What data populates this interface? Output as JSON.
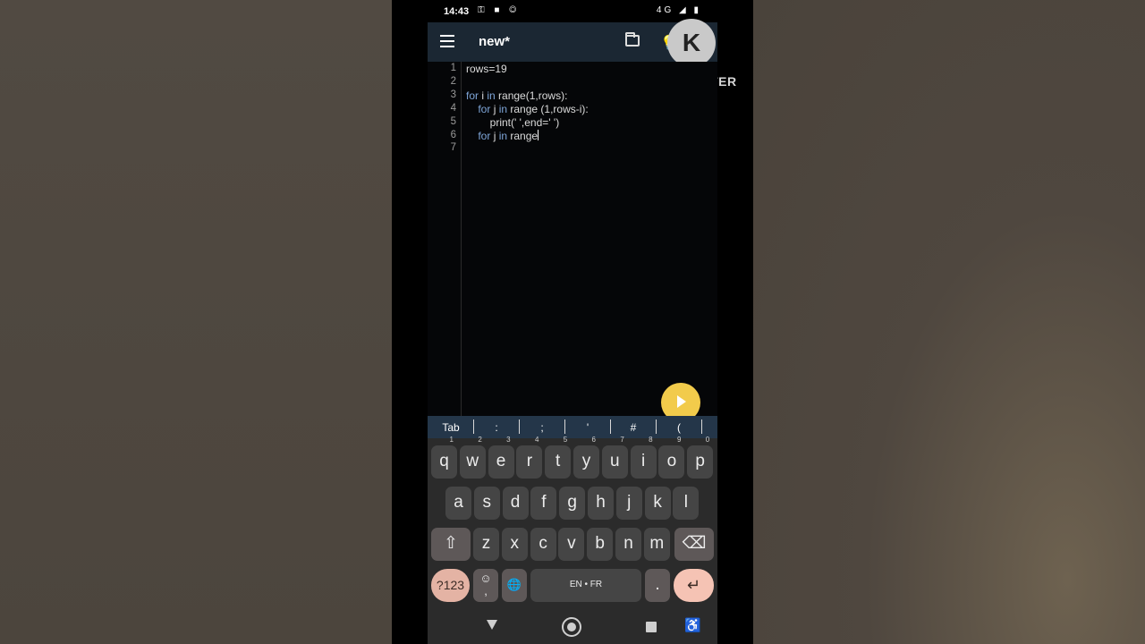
{
  "status_bar": {
    "time": "14:43",
    "left_icons": "⚿ ■ ◎",
    "right_icons": "4G ◢ ▮"
  },
  "app": {
    "title": "new*"
  },
  "overlay": {
    "logo_letter": "K",
    "brand": "KINEMASTER"
  },
  "editor": {
    "lines": [
      {
        "number": "1",
        "indent": "",
        "tokens": [
          {
            "text": "rows=19",
            "kw": false
          }
        ]
      },
      {
        "number": "2",
        "indent": "",
        "tokens": []
      },
      {
        "number": "3",
        "indent": "",
        "tokens": [
          {
            "text": "for",
            "kw": true
          },
          {
            "text": " i ",
            "kw": false
          },
          {
            "text": "in",
            "kw": true
          },
          {
            "text": " range(1,rows):",
            "kw": false
          }
        ]
      },
      {
        "number": "4",
        "indent": "  ",
        "tokens": [
          {
            "text": "for",
            "kw": true
          },
          {
            "text": " j ",
            "kw": false
          },
          {
            "text": "in",
            "kw": true
          },
          {
            "text": " range (1,rows-i):",
            "kw": false
          }
        ]
      },
      {
        "number": "5",
        "indent": "    ",
        "tokens": [
          {
            "text": "print(' ',end=' ')",
            "kw": false
          }
        ]
      },
      {
        "number": "6",
        "indent": "  ",
        "tokens": [
          {
            "text": "for",
            "kw": true
          },
          {
            "text": " j ",
            "kw": false
          },
          {
            "text": "in",
            "kw": true
          },
          {
            "text": " range",
            "kw": false
          }
        ],
        "caret": true
      },
      {
        "number": "7",
        "indent": "",
        "tokens": []
      }
    ]
  },
  "symbol_bar": [
    "Tab",
    ":",
    ";",
    "'",
    "#",
    "("
  ],
  "keyboard": {
    "row1": [
      {
        "k": "q",
        "h": "1"
      },
      {
        "k": "w",
        "h": "2"
      },
      {
        "k": "e",
        "h": "3"
      },
      {
        "k": "r",
        "h": "4"
      },
      {
        "k": "t",
        "h": "5"
      },
      {
        "k": "y",
        "h": "6"
      },
      {
        "k": "u",
        "h": "7"
      },
      {
        "k": "i",
        "h": "8"
      },
      {
        "k": "o",
        "h": "9"
      },
      {
        "k": "p",
        "h": "0"
      }
    ],
    "row2": [
      "a",
      "s",
      "d",
      "f",
      "g",
      "h",
      "j",
      "k",
      "l"
    ],
    "row3": [
      "z",
      "x",
      "c",
      "v",
      "b",
      "n",
      "m"
    ],
    "shift": "⇧",
    "backspace": "⌫",
    "numbers": "?123",
    "emoji": "☺",
    "comma": ",",
    "globe": "🌐",
    "space": "EN • FR",
    "period": ".",
    "enter": "↵"
  },
  "nav": {
    "accessibility": "♿"
  }
}
